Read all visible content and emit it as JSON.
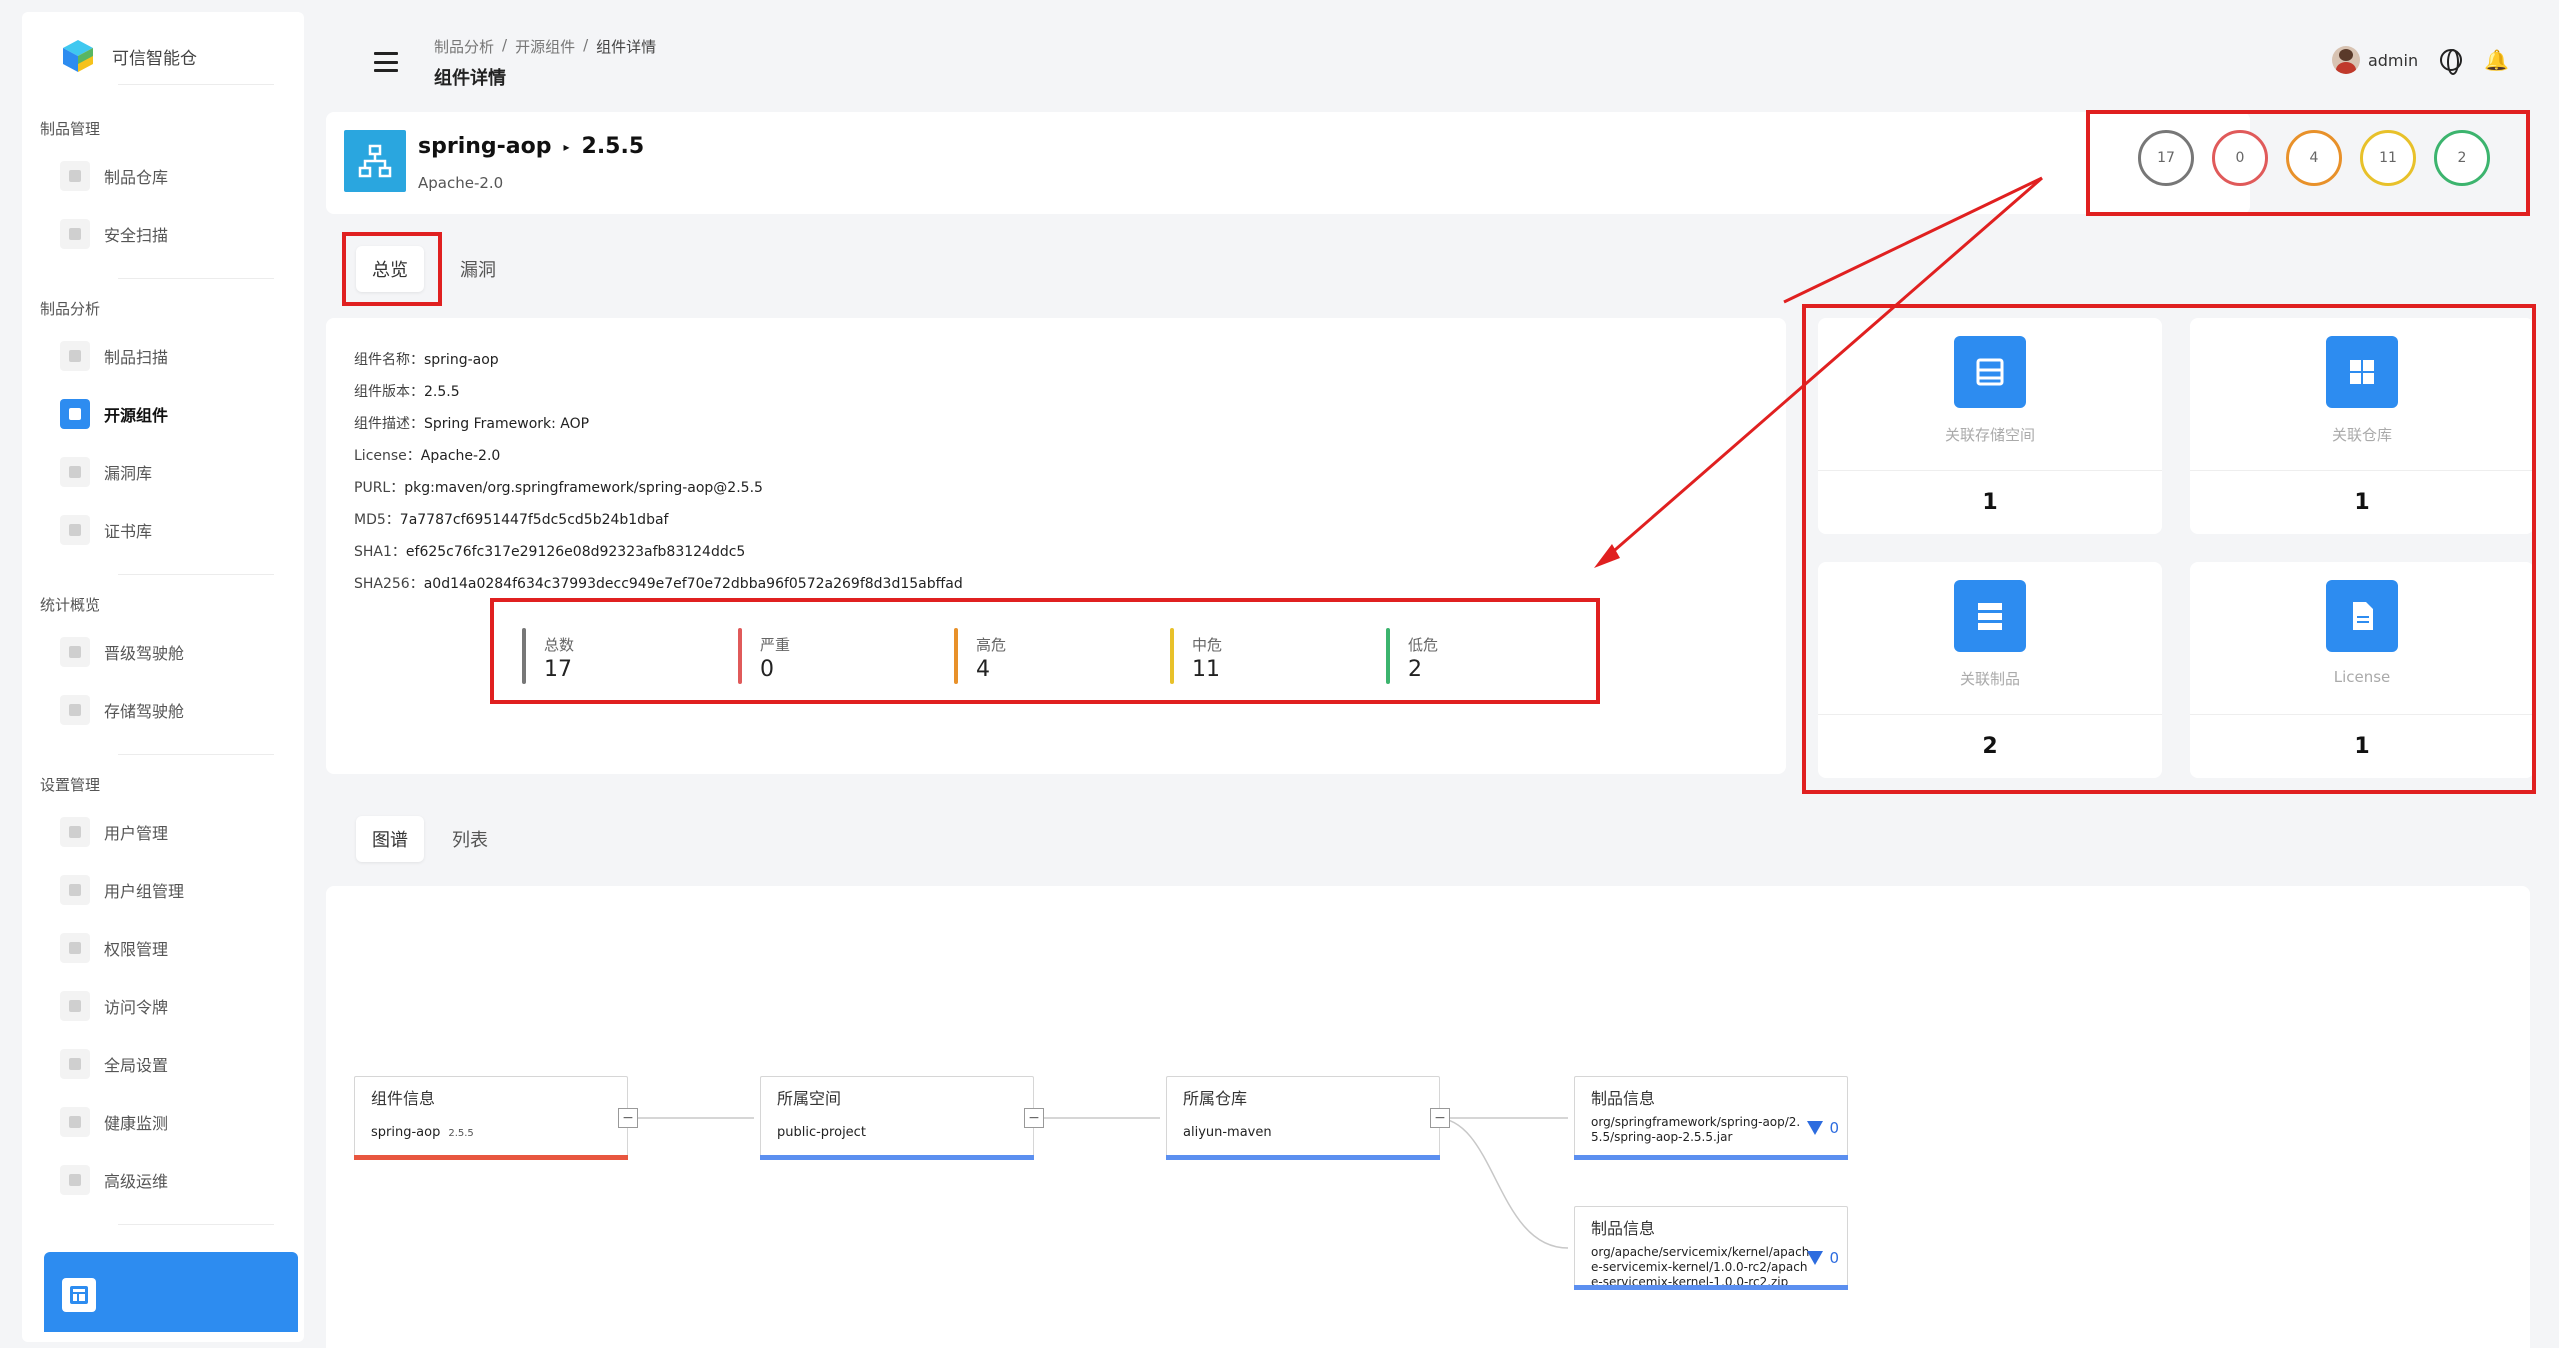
{
  "brand": {
    "name": "可信智能仓"
  },
  "sidebar": {
    "groups": [
      {
        "title": "制品管理",
        "items": [
          {
            "label": "制品仓库",
            "icon": "grid-icon"
          },
          {
            "label": "安全扫描",
            "icon": "scan-icon"
          }
        ]
      },
      {
        "title": "制品分析",
        "items": [
          {
            "label": "制品扫描",
            "icon": "doc-icon"
          },
          {
            "label": "开源组件",
            "icon": "component-icon",
            "active": true
          },
          {
            "label": "漏洞库",
            "icon": "bug-icon"
          },
          {
            "label": "证书库",
            "icon": "certificate-icon"
          }
        ]
      },
      {
        "title": "统计概览",
        "items": [
          {
            "label": "晋级驾驶舱",
            "icon": "promotion-icon"
          },
          {
            "label": "存储驾驶舱",
            "icon": "storage-icon"
          }
        ]
      },
      {
        "title": "设置管理",
        "items": [
          {
            "label": "用户管理",
            "icon": "user-icon"
          },
          {
            "label": "用户组管理",
            "icon": "user-group-icon"
          },
          {
            "label": "权限管理",
            "icon": "permission-icon"
          },
          {
            "label": "访问令牌",
            "icon": "lock-icon"
          },
          {
            "label": "全局设置",
            "icon": "wrench-icon"
          },
          {
            "label": "健康监测",
            "icon": "health-icon"
          },
          {
            "label": "高级运维",
            "icon": "ops-icon"
          }
        ]
      }
    ]
  },
  "header": {
    "breadcrumb": [
      "制品分析",
      "开源组件",
      "组件详情"
    ],
    "title": "组件详情",
    "user": "admin"
  },
  "component": {
    "name": "spring-aop",
    "version": "2.5.5",
    "license": "Apache-2.0"
  },
  "severity_circles": [
    {
      "value": "17",
      "color": "#777777"
    },
    {
      "value": "0",
      "color": "#e05a5a"
    },
    {
      "value": "4",
      "color": "#e8912a"
    },
    {
      "value": "11",
      "color": "#e8c12a"
    },
    {
      "value": "2",
      "color": "#3cb46e"
    }
  ],
  "tabs": [
    "总览",
    "漏洞"
  ],
  "info": [
    {
      "key": "组件名称：",
      "value": "spring-aop"
    },
    {
      "key": "组件版本：",
      "value": "2.5.5"
    },
    {
      "key": "组件描述：",
      "value": "Spring Framework: AOP"
    },
    {
      "key": "License：",
      "value": "Apache-2.0"
    },
    {
      "key": "PURL：",
      "value": "pkg:maven/org.springframework/spring-aop@2.5.5"
    },
    {
      "key": "MD5：",
      "value": "7a7787cf6951447f5dc5cd5b24b1dbaf"
    },
    {
      "key": "SHA1：",
      "value": "ef625c76fc317e29126e08d92323afb83124ddc5"
    },
    {
      "key": "SHA256：",
      "value": "a0d14a0284f634c37993decc949e7ef70e72dbba96f0572a269f8d3d15abffad"
    }
  ],
  "stats": [
    {
      "label": "总数",
      "value": "17",
      "color": "#777777"
    },
    {
      "label": "严重",
      "value": "0",
      "color": "#e05a5a"
    },
    {
      "label": "高危",
      "value": "4",
      "color": "#e8912a"
    },
    {
      "label": "中危",
      "value": "11",
      "color": "#e8c12a"
    },
    {
      "label": "低危",
      "value": "2",
      "color": "#3cb46e"
    }
  ],
  "related": [
    {
      "label": "关联存储空间",
      "value": "1",
      "icon": "storage-icon"
    },
    {
      "label": "关联仓库",
      "value": "1",
      "icon": "repository-icon"
    },
    {
      "label": "关联制品",
      "value": "2",
      "icon": "artifact-icon"
    },
    {
      "label": "License",
      "value": "1",
      "icon": "license-icon"
    }
  ],
  "tabs2": [
    "图谱",
    "列表"
  ],
  "graph": {
    "nodes": [
      {
        "title": "组件信息",
        "value": "spring-aop",
        "sub": "2.5.5",
        "bar": "#e8563f"
      },
      {
        "title": "所属空间",
        "value": "public-project",
        "bar": "#5b8ff0"
      },
      {
        "title": "所属仓库",
        "value": "aliyun-maven",
        "bar": "#5b8ff0"
      },
      {
        "title": "制品信息",
        "path": "org/springframework/spring-aop/2.5.5/spring-aop-2.5.5.jar",
        "count": "0",
        "bar": "#5b8ff0"
      },
      {
        "title": "制品信息",
        "path": "org/apache/servicemix/kernel/apache-servicemix-kernel/1.0.0-rc2/apache-servicemix-kernel-1.0.0-rc2.zip",
        "count": "0",
        "bar": "#5b8ff0"
      }
    ],
    "collapse_symbol": "−"
  }
}
